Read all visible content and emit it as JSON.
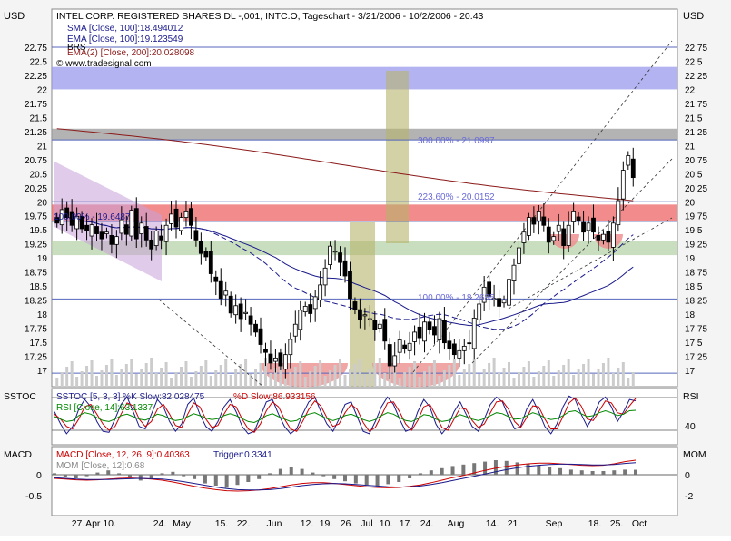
{
  "header": {
    "title": "INTEL CORP. REGISTERED SHARES DL -,001, INTC.O, Tageschart - 3/21/2006 - 10/2/2006 - 20.43",
    "currency_left": "USD",
    "currency_right": "USD",
    "copyright": "© www.tradesignal.com"
  },
  "chart_data": [
    {
      "type": "candlestick",
      "panel": "price",
      "symbol": "INTC.O",
      "ylim": [
        16.8,
        23.0
      ],
      "y_ticks": [
        17,
        17.25,
        17.5,
        17.75,
        18,
        18.25,
        18.5,
        18.75,
        19,
        19.25,
        19.5,
        19.75,
        20,
        20.25,
        20.5,
        20.75,
        21,
        21.25,
        21.5,
        21.75,
        22,
        22.25,
        22.5,
        22.75
      ],
      "legend": [
        {
          "name": "SMA [Close, 100]:18.494012",
          "color": "#1a1a8c"
        },
        {
          "name": "EMA [Close, 100]:19.123549",
          "color": "#1a1a8c"
        },
        {
          "name": "BRS",
          "color": "#000000"
        },
        {
          "name": "EMA(2) [Close, 200]:20.028098",
          "color": "#8b1a1a"
        }
      ],
      "annotations": [
        "300.00% - 21.0997",
        "223.60% - 20.0152",
        "100.00% - 18.2685",
        "100.00% - 19.6487"
      ],
      "zones": [
        {
          "from": 22.0,
          "to": 22.4,
          "color": "#9999ee"
        },
        {
          "from": 21.1,
          "to": 21.3,
          "color": "#999999"
        },
        {
          "from": 19.65,
          "to": 19.95,
          "color": "#ee6666"
        },
        {
          "from": 19.05,
          "to": 19.3,
          "color": "#b5d3a8"
        }
      ],
      "series": [
        {
          "name": "Close",
          "values": [
            19.62,
            19.86,
            19.72,
            19.58,
            19.74,
            19.52,
            19.48,
            19.59,
            19.43,
            19.34,
            19.46,
            19.24,
            19.38,
            19.68,
            19.42,
            19.85,
            19.34,
            19.62,
            19.32,
            19.16,
            19.48,
            19.32,
            19.58,
            19.78,
            19.55,
            19.72,
            19.82,
            19.58,
            19.32,
            19.08,
            19.02,
            18.72,
            18.58,
            18.28,
            18.41,
            18.02,
            18.15,
            17.92,
            18.03,
            17.82,
            17.68,
            17.46,
            17.32,
            17.13,
            17.22,
            17.08,
            17.28,
            17.55,
            17.82,
            18.07,
            18.14,
            18.01,
            18.31,
            18.52,
            18.82,
            19.21,
            19.12,
            18.92,
            18.68,
            18.28,
            18.08,
            17.91,
            17.99,
            17.92,
            17.72,
            17.82,
            17.52,
            17.08,
            17.26,
            17.54,
            17.38,
            17.48,
            17.68,
            17.58,
            17.86,
            17.72,
            17.63,
            17.92,
            17.49,
            17.38,
            17.28,
            17.35,
            17.43,
            17.48,
            17.93,
            18.18,
            18.48,
            18.32,
            18.28,
            18.14,
            18.25,
            18.62,
            18.87,
            19.18,
            19.46,
            19.72,
            19.6,
            19.82,
            19.58,
            19.28,
            19.38,
            19.58,
            19.22,
            19.58,
            19.82,
            19.66,
            19.46,
            19.62,
            19.46,
            19.32,
            19.42,
            19.28,
            19.62,
            20.02,
            20.56,
            20.82,
            20.43
          ]
        }
      ]
    },
    {
      "type": "line",
      "panel": "stochastic-rsi",
      "legend": [
        {
          "name": "SSTOC [5, 3, 3] %K Slow:82.028475",
          "color": "#1a1a8c"
        },
        {
          "name": "%D Slow:86.933156",
          "color": "#cc0000"
        },
        {
          "name": "RSI [Close, 14]:63.1337",
          "color": "#008800"
        }
      ],
      "left_label": "SSTOC",
      "right_label": "RSI",
      "right_tick": "40",
      "series": [
        {
          "name": "%K Slow",
          "values": [
            60,
            35,
            15,
            30,
            65,
            85,
            70,
            40,
            20,
            18,
            45,
            75,
            90,
            60,
            30,
            25,
            55,
            85,
            70,
            40,
            20,
            35,
            75,
            88,
            55,
            30,
            20,
            40,
            70,
            85,
            60,
            30,
            15,
            20,
            50,
            80,
            85,
            55,
            30,
            15,
            25,
            55,
            80,
            90,
            60,
            35,
            20,
            45,
            75,
            80,
            50,
            20,
            15,
            40,
            70,
            90,
            75,
            45,
            20,
            25,
            60,
            85,
            70,
            35,
            15,
            30,
            60,
            80,
            55,
            30,
            20,
            45,
            75,
            90,
            80,
            50,
            25,
            30,
            65,
            85,
            60,
            30,
            15,
            35,
            70,
            92,
            85,
            55,
            30,
            50,
            80,
            90,
            70,
            40,
            60,
            85,
            82
          ]
        },
        {
          "name": "%D Slow",
          "values": [
            55,
            45,
            30,
            25,
            45,
            70,
            75,
            55,
            35,
            22,
            30,
            55,
            78,
            72,
            45,
            30,
            40,
            65,
            75,
            55,
            32,
            28,
            55,
            78,
            70,
            45,
            28,
            32,
            55,
            75,
            70,
            45,
            25,
            18,
            35,
            62,
            80,
            70,
            45,
            25,
            20,
            40,
            65,
            82,
            72,
            48,
            30,
            35,
            58,
            75,
            65,
            38,
            20,
            28,
            52,
            78,
            80,
            60,
            35,
            22,
            42,
            70,
            75,
            52,
            28,
            22,
            45,
            68,
            65,
            42,
            28,
            35,
            58,
            80,
            82,
            65,
            40,
            28,
            48,
            72,
            70,
            45,
            25,
            25,
            50,
            78,
            88,
            72,
            45,
            42,
            62,
            82,
            78,
            58,
            55,
            72,
            87
          ]
        },
        {
          "name": "RSI",
          "values": [
            50,
            45,
            40,
            42,
            52,
            58,
            55,
            48,
            42,
            40,
            45,
            52,
            55,
            50,
            45,
            43,
            48,
            55,
            52,
            46,
            42,
            44,
            50,
            56,
            52,
            47,
            44,
            46,
            52,
            56,
            52,
            46,
            40,
            38,
            44,
            52,
            56,
            50,
            45,
            40,
            42,
            50,
            55,
            58,
            52,
            46,
            42,
            46,
            52,
            55,
            50,
            44,
            40,
            44,
            52,
            58,
            55,
            48,
            42,
            40,
            46,
            54,
            52,
            45,
            40,
            42,
            48,
            54,
            50,
            45,
            42,
            46,
            52,
            58,
            56,
            50,
            45,
            46,
            52,
            58,
            54,
            48,
            44,
            46,
            52,
            60,
            62,
            56,
            50,
            52,
            58,
            62,
            58,
            52,
            55,
            62,
            63
          ]
        }
      ]
    },
    {
      "type": "bar-line",
      "panel": "macd",
      "legend": [
        {
          "name": "MACD [Close, 12, 26, 9]:0.40363",
          "color": "#cc0000"
        },
        {
          "name": "Trigger:0.3341",
          "color": "#1a1a8c"
        },
        {
          "name": "MOM [Close, 12]:0.68",
          "color": "#888888"
        }
      ],
      "left_label": "MACD",
      "right_label": "MOM",
      "left_ticks": [
        "0",
        "-0.5"
      ],
      "right_ticks": [
        "0",
        "-2"
      ],
      "series": [
        {
          "name": "MACD",
          "values": [
            -0.1,
            -0.12,
            -0.14,
            -0.15,
            -0.14,
            -0.12,
            -0.1,
            -0.09,
            -0.1,
            -0.12,
            -0.15,
            -0.2,
            -0.26,
            -0.32,
            -0.37,
            -0.41,
            -0.44,
            -0.45,
            -0.44,
            -0.42,
            -0.38,
            -0.33,
            -0.28,
            -0.24,
            -0.22,
            -0.22,
            -0.24,
            -0.27,
            -0.3,
            -0.33,
            -0.35,
            -0.36,
            -0.35,
            -0.32,
            -0.28,
            -0.22,
            -0.15,
            -0.08,
            -0.02,
            0.05,
            0.12,
            0.18,
            0.23,
            0.27,
            0.3,
            0.32,
            0.32,
            0.3,
            0.28,
            0.26,
            0.25,
            0.26,
            0.3,
            0.36,
            0.4
          ]
        },
        {
          "name": "Trigger",
          "values": [
            -0.08,
            -0.1,
            -0.12,
            -0.13,
            -0.13,
            -0.13,
            -0.12,
            -0.11,
            -0.1,
            -0.11,
            -0.12,
            -0.15,
            -0.19,
            -0.24,
            -0.29,
            -0.34,
            -0.38,
            -0.41,
            -0.42,
            -0.42,
            -0.41,
            -0.38,
            -0.34,
            -0.3,
            -0.27,
            -0.25,
            -0.24,
            -0.25,
            -0.27,
            -0.29,
            -0.31,
            -0.33,
            -0.34,
            -0.33,
            -0.31,
            -0.27,
            -0.22,
            -0.16,
            -0.1,
            -0.04,
            0.02,
            0.08,
            0.14,
            0.19,
            0.23,
            0.26,
            0.28,
            0.29,
            0.29,
            0.28,
            0.27,
            0.27,
            0.28,
            0.31,
            0.33
          ]
        },
        {
          "name": "MOM",
          "values": [
            0.2,
            -0.3,
            -0.5,
            -0.2,
            0.3,
            0.6,
            0.2,
            -0.4,
            -0.8,
            -0.6,
            0.2,
            0.4,
            -0.2,
            -0.6,
            -1.2,
            -1.5,
            -1.8,
            -1.4,
            -1.0,
            -0.6,
            0.2,
            0.8,
            1.1,
            0.8,
            0.3,
            -0.2,
            -0.6,
            -0.9,
            -1.2,
            -1.4,
            -1.6,
            -1.3,
            -1.0,
            -0.5,
            0.2,
            0.6,
            0.9,
            1.2,
            1.4,
            1.6,
            1.8,
            2.0,
            1.9,
            1.7,
            1.5,
            1.3,
            1.1,
            0.9,
            0.7,
            0.6,
            0.5,
            0.5,
            0.6,
            0.7,
            0.68
          ]
        }
      ]
    }
  ],
  "x_axis": {
    "labels": [
      "27.",
      "Apr 10.",
      "24.",
      "May",
      "15.",
      "22.",
      "Jun",
      "12.",
      "19.",
      "26.",
      "Jul",
      "10.",
      "17.",
      "24.",
      "Aug",
      "14.",
      "21.",
      "Sep",
      "18.",
      "25.",
      "Oct"
    ]
  },
  "colors": {
    "background": "#f4f4f4",
    "plot_background": "#ffffff",
    "candle_up": "#ffffff",
    "candle_down": "#000000",
    "channel": "#c8a0d8",
    "olive_zone": "#b5b36a",
    "pink_zone": "#ee9090",
    "volume": "#cccccc"
  }
}
